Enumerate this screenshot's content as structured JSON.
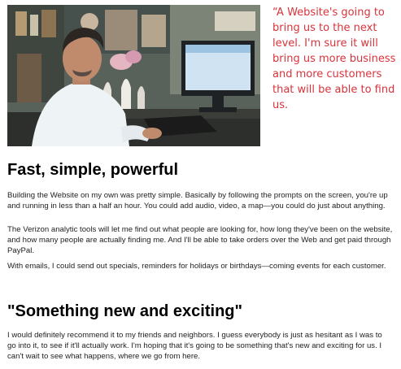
{
  "photo": {
    "alt": "Man seated at a desk in front of a computer monitor"
  },
  "quote": "“A Website's going to bring us to the next level. I'm sure it will bring us more business and more customers that will be able to find us.",
  "sections": [
    {
      "heading": "Fast, simple, powerful",
      "paragraphs": [
        "Building the Website on my own was pretty simple. Basically by following the prompts on the screen, you're up and running in less than a half an hour. You could add audio, video, a map—you could do just about anything.",
        "The Verizon analytic tools will let me find out what people are looking for, how long they've been on the website, and how many people are actually finding me. And I'll be able to take orders over the Web and get paid through PayPal.",
        "With emails, I could send out specials, reminders for holidays or birthdays—coming events for each customer."
      ]
    },
    {
      "heading": "\"Something new and exciting\"",
      "paragraphs": [
        "I would definitely recommend it to my friends and neighbors. I guess everybody is just as hesitant as I was to go into it, to see if it'll actually work. I'm hoping that it's going to be something that's new and exciting for us. I can't wait to see what happens, where we go from here."
      ]
    }
  ]
}
